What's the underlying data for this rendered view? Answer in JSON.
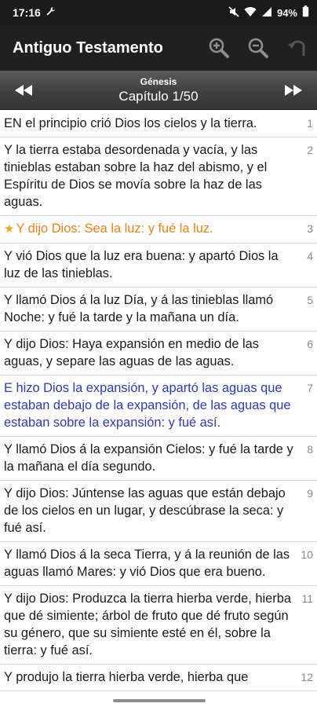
{
  "status": {
    "time": "17:16",
    "battery": "94%"
  },
  "header": {
    "title": "Antiguo Testamento",
    "icons": [
      "zoom-in-icon",
      "zoom-out-icon",
      "undo-icon"
    ]
  },
  "chapter_nav": {
    "book": "Génesis",
    "chapter_label": "Capítulo  1/50"
  },
  "verses": [
    {
      "num": "1",
      "text": "EN el principio crió Dios los cielos y la tierra."
    },
    {
      "num": "2",
      "text": "Y la tierra estaba desordenada y vacía, y las tinieblas estaban sobre la haz del abismo, y el Espíritu de Dios se movía sobre la haz de las aguas."
    },
    {
      "num": "3",
      "text": "Y dijo Dios: Sea la luz: y fué la luz.",
      "style": "orange",
      "starred": true
    },
    {
      "num": "4",
      "text": "Y vió Dios que la luz era buena: y apartó Dios la luz de las tinieblas."
    },
    {
      "num": "5",
      "text": "Y llamó Dios á la luz Día, y á las tinieblas llamó Noche: y fué la tarde y la mañana un día."
    },
    {
      "num": "6",
      "text": "Y dijo Dios: Haya expansión en medio de las aguas, y separe las aguas de las aguas."
    },
    {
      "num": "7",
      "text": "E hizo Dios la expansión, y apartó las aguas que estaban debajo de la expansión, de las aguas que estaban sobre la expansión: y fué así.",
      "style": "blue"
    },
    {
      "num": "8",
      "text": "Y llamó Dios á la expansión Cielos: y fué la tarde y la mañana el día segundo."
    },
    {
      "num": "9",
      "text": "Y dijo Dios: Júntense las aguas que están debajo de los cielos en un lugar, y descúbrase la seca: y fué así."
    },
    {
      "num": "10",
      "text": "Y llamó Dios á la seca Tierra, y á la reunión de las aguas llamó Mares: y vió Dios que era bueno."
    },
    {
      "num": "11",
      "text": "Y dijo Dios: Produzca la tierra hierba verde, hierba que dé simiente; árbol de fruto que dé fruto según su género, que su simiente esté en él, sobre la tierra: y fué así."
    },
    {
      "num": "12",
      "text": "Y produjo la tierra hierba verde, hierba que"
    }
  ]
}
